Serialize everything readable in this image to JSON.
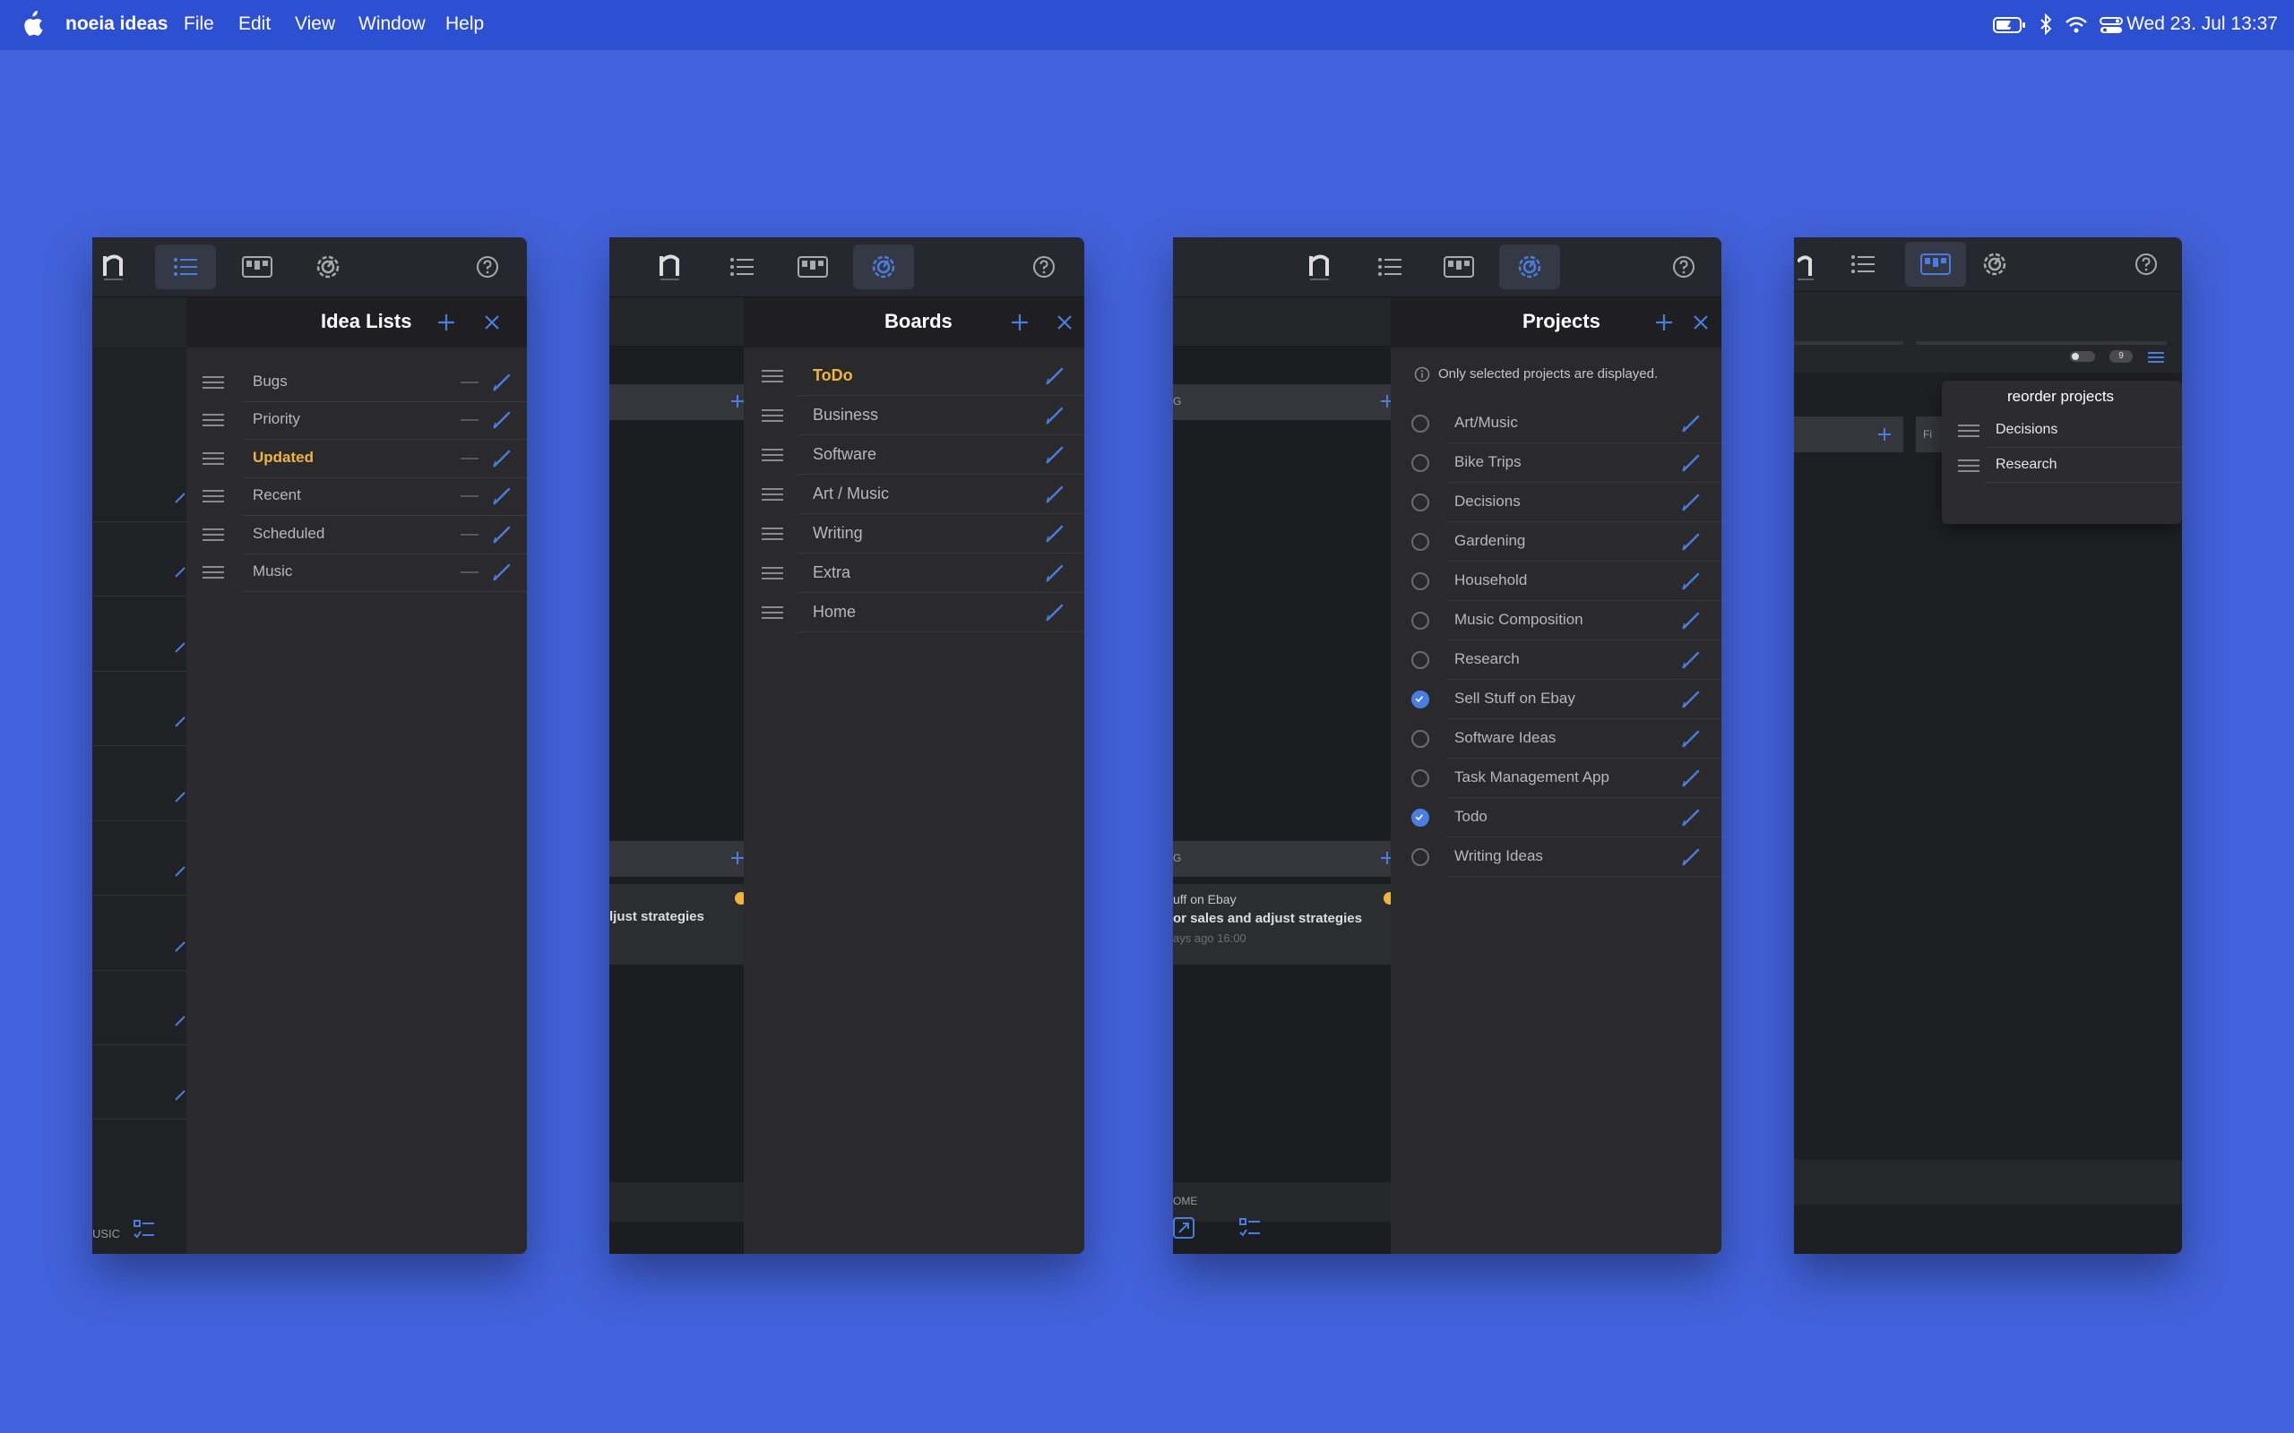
{
  "menubar": {
    "app_name": "noeia ideas",
    "menus": [
      "File",
      "Edit",
      "View",
      "Window",
      "Help"
    ],
    "clock": "Wed 23. Jul  13:37"
  },
  "idea_lists": {
    "title": "Idea Lists",
    "items": [
      {
        "label": "Bugs",
        "highlighted": false
      },
      {
        "label": "Priority",
        "highlighted": false
      },
      {
        "label": "Updated",
        "highlighted": true
      },
      {
        "label": "Recent",
        "highlighted": false
      },
      {
        "label": "Scheduled",
        "highlighted": false
      },
      {
        "label": "Music",
        "highlighted": false
      }
    ],
    "bg_fragment": "USIC"
  },
  "boards": {
    "title": "Boards",
    "items": [
      {
        "label": "ToDo",
        "highlighted": true
      },
      {
        "label": "Business",
        "highlighted": false
      },
      {
        "label": "Software",
        "highlighted": false
      },
      {
        "label": "Art / Music",
        "highlighted": false
      },
      {
        "label": "Writing",
        "highlighted": false
      },
      {
        "label": "Extra",
        "highlighted": false
      },
      {
        "label": "Home",
        "highlighted": false
      }
    ],
    "bg_card_text": "ljust strategies"
  },
  "projects": {
    "title": "Projects",
    "info": "Only selected projects are displayed.",
    "items": [
      {
        "label": "Art/Music",
        "checked": false
      },
      {
        "label": "Bike Trips",
        "checked": false
      },
      {
        "label": "Decisions",
        "checked": false
      },
      {
        "label": "Gardening",
        "checked": false
      },
      {
        "label": "Household",
        "checked": false
      },
      {
        "label": "Music Composition",
        "checked": false
      },
      {
        "label": "Research",
        "checked": false
      },
      {
        "label": "Sell Stuff on Ebay",
        "checked": true
      },
      {
        "label": "Software Ideas",
        "checked": false
      },
      {
        "label": "Task Management App",
        "checked": false
      },
      {
        "label": "Todo",
        "checked": true
      },
      {
        "label": "Writing Ideas",
        "checked": false
      }
    ],
    "bg_card": {
      "line1": "uff on Ebay",
      "line2": "or sales and adjust strategies",
      "line3": "ays ago 16:00"
    },
    "bg_fragment_g1": "G",
    "bg_fragment_g2": "G",
    "bg_footer": "OME"
  },
  "reorder": {
    "title": "reorder projects",
    "items": [
      "Decisions",
      "Research"
    ],
    "filter_fragment": "Fi",
    "badge": "9"
  },
  "colors": {
    "accent": "#4a7de0",
    "highlight": "#f0b43c",
    "desktop": "#4262db",
    "menubar": "#2d4fd1"
  }
}
